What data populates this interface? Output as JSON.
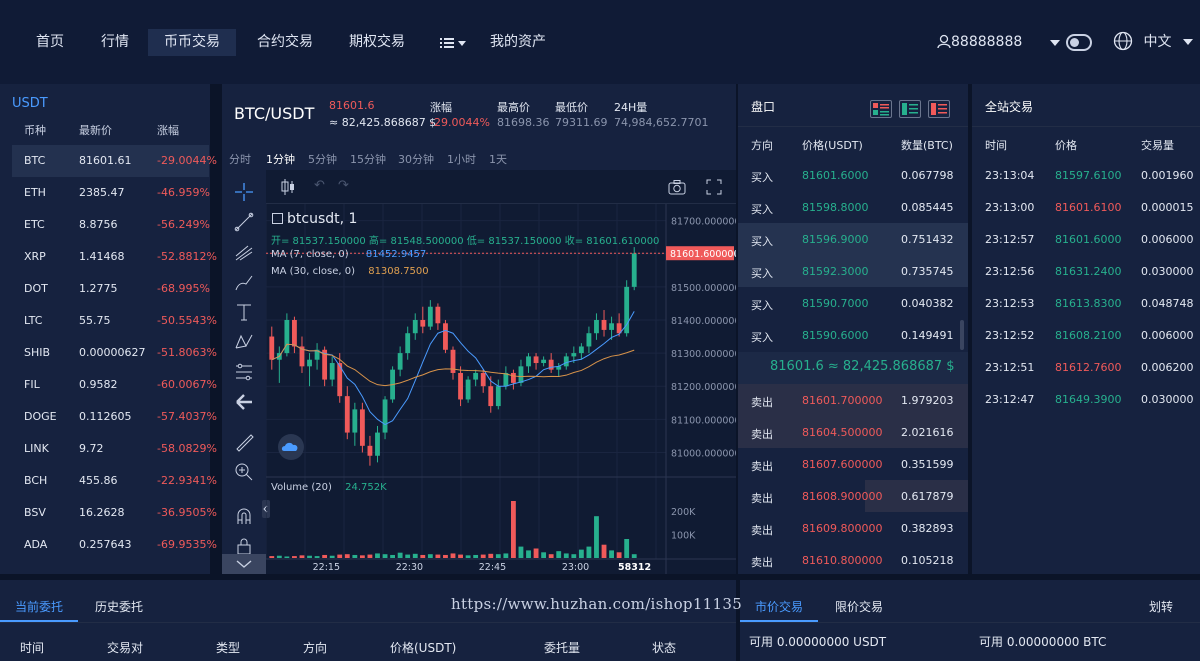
{
  "nav": {
    "items": [
      "首页",
      "行情",
      "币币交易",
      "合约交易",
      "期权交易"
    ],
    "assets": "我的资产",
    "user": "88888888",
    "language": "中文"
  },
  "markets": {
    "title": "USDT",
    "headers": [
      "币种",
      "最新价",
      "涨幅"
    ],
    "rows": [
      {
        "sym": "BTC",
        "price": "81601.61",
        "chg": "-29.0044%"
      },
      {
        "sym": "ETH",
        "price": "2385.47",
        "chg": "-46.959%"
      },
      {
        "sym": "ETC",
        "price": "8.8756",
        "chg": "-56.249%"
      },
      {
        "sym": "XRP",
        "price": "1.41468",
        "chg": "-52.8812%"
      },
      {
        "sym": "DOT",
        "price": "1.2775",
        "chg": "-68.995%"
      },
      {
        "sym": "LTC",
        "price": "55.75",
        "chg": "-50.5543%"
      },
      {
        "sym": "SHIB",
        "price": "0.00000627",
        "chg": "-51.8063%"
      },
      {
        "sym": "FIL",
        "price": "0.9582",
        "chg": "-60.0067%"
      },
      {
        "sym": "DOGE",
        "price": "0.112605",
        "chg": "-57.4037%"
      },
      {
        "sym": "LINK",
        "price": "9.72",
        "chg": "-58.0829%"
      },
      {
        "sym": "BCH",
        "price": "455.86",
        "chg": "-22.9341%"
      },
      {
        "sym": "BSV",
        "price": "16.2628",
        "chg": "-36.9505%"
      },
      {
        "sym": "ADA",
        "price": "0.257643",
        "chg": "-69.9535%"
      }
    ]
  },
  "ticker": {
    "pair": "BTC/USDT",
    "last": "81601.6",
    "last_usd": "≈ 82,425.868687 $",
    "chg_label": "涨幅",
    "chg": "-29.0044%",
    "high_label": "最高价",
    "high": "81698.36",
    "low_label": "最低价",
    "low": "79311.69",
    "vol_label": "24H量",
    "vol": "74,984,652.7701"
  },
  "intervals": [
    "分时",
    "1分钟",
    "5分钟",
    "15分钟",
    "30分钟",
    "1小时",
    "1天"
  ],
  "chart": {
    "symbol": "btcusdt, 1",
    "ohlc": "开= 81537.150000  高= 81548.500000  低= 81537.150000  收= 81601.610000",
    "ma7_label": "MA (7, close, 0)",
    "ma7_val": "81452.9457",
    "ma30_label": "MA (30, close, 0)",
    "ma30_val": "81308.7500",
    "volume_label": "Volume (20)",
    "volume_val": "24.752K",
    "price_ticks": [
      "81700.000000",
      "81600.000000",
      "81500.000000",
      "81400.000000",
      "81300.000000",
      "81200.000000",
      "81100.000000",
      "81000.000000"
    ],
    "current_price": "81601.600000",
    "vol_ticks": [
      "200K",
      "100K"
    ],
    "time_ticks": [
      "22:15",
      "22:30",
      "22:45",
      "23:00"
    ],
    "cursor_time": "58312"
  },
  "chart_data": {
    "type": "candlestick",
    "ylim": [
      80950,
      81720
    ],
    "candles": [
      {
        "o": 81350,
        "h": 81380,
        "l": 81250,
        "c": 81280
      },
      {
        "o": 81280,
        "h": 81320,
        "l": 81210,
        "c": 81300
      },
      {
        "o": 81300,
        "h": 81420,
        "l": 81290,
        "c": 81400
      },
      {
        "o": 81400,
        "h": 81410,
        "l": 81300,
        "c": 81320
      },
      {
        "o": 81320,
        "h": 81350,
        "l": 81240,
        "c": 81260
      },
      {
        "o": 81260,
        "h": 81300,
        "l": 81200,
        "c": 81280
      },
      {
        "o": 81280,
        "h": 81330,
        "l": 81250,
        "c": 81310
      },
      {
        "o": 81310,
        "h": 81320,
        "l": 81200,
        "c": 81220
      },
      {
        "o": 81220,
        "h": 81290,
        "l": 81200,
        "c": 81270
      },
      {
        "o": 81270,
        "h": 81300,
        "l": 81150,
        "c": 81170
      },
      {
        "o": 81170,
        "h": 81200,
        "l": 81040,
        "c": 81060
      },
      {
        "o": 81060,
        "h": 81150,
        "l": 81020,
        "c": 81130
      },
      {
        "o": 81130,
        "h": 81150,
        "l": 81000,
        "c": 81020
      },
      {
        "o": 81020,
        "h": 81050,
        "l": 80960,
        "c": 80990
      },
      {
        "o": 80990,
        "h": 81080,
        "l": 80970,
        "c": 81060
      },
      {
        "o": 81060,
        "h": 81170,
        "l": 81040,
        "c": 81160
      },
      {
        "o": 81160,
        "h": 81260,
        "l": 81150,
        "c": 81250
      },
      {
        "o": 81250,
        "h": 81320,
        "l": 81230,
        "c": 81300
      },
      {
        "o": 81300,
        "h": 81380,
        "l": 81280,
        "c": 81360
      },
      {
        "o": 81360,
        "h": 81420,
        "l": 81340,
        "c": 81400
      },
      {
        "o": 81400,
        "h": 81440,
        "l": 81360,
        "c": 81380
      },
      {
        "o": 81380,
        "h": 81460,
        "l": 81370,
        "c": 81440
      },
      {
        "o": 81440,
        "h": 81450,
        "l": 81370,
        "c": 81390
      },
      {
        "o": 81390,
        "h": 81400,
        "l": 81300,
        "c": 81310
      },
      {
        "o": 81310,
        "h": 81320,
        "l": 81220,
        "c": 81240
      },
      {
        "o": 81240,
        "h": 81260,
        "l": 81140,
        "c": 81160
      },
      {
        "o": 81160,
        "h": 81230,
        "l": 81150,
        "c": 81220
      },
      {
        "o": 81220,
        "h": 81250,
        "l": 81200,
        "c": 81240
      },
      {
        "o": 81240,
        "h": 81250,
        "l": 81180,
        "c": 81200
      },
      {
        "o": 81200,
        "h": 81230,
        "l": 81120,
        "c": 81140
      },
      {
        "o": 81140,
        "h": 81220,
        "l": 81130,
        "c": 81200
      },
      {
        "o": 81200,
        "h": 81260,
        "l": 81190,
        "c": 81240
      },
      {
        "o": 81240,
        "h": 81250,
        "l": 81190,
        "c": 81210
      },
      {
        "o": 81210,
        "h": 81280,
        "l": 81200,
        "c": 81260
      },
      {
        "o": 81260,
        "h": 81300,
        "l": 81240,
        "c": 81290
      },
      {
        "o": 81290,
        "h": 81300,
        "l": 81250,
        "c": 81270
      },
      {
        "o": 81270,
        "h": 81290,
        "l": 81260,
        "c": 81280
      },
      {
        "o": 81280,
        "h": 81300,
        "l": 81240,
        "c": 81250
      },
      {
        "o": 81250,
        "h": 81270,
        "l": 81230,
        "c": 81260
      },
      {
        "o": 81260,
        "h": 81300,
        "l": 81250,
        "c": 81290
      },
      {
        "o": 81290,
        "h": 81320,
        "l": 81270,
        "c": 81300
      },
      {
        "o": 81300,
        "h": 81330,
        "l": 81280,
        "c": 81320
      },
      {
        "o": 81320,
        "h": 81380,
        "l": 81300,
        "c": 81360
      },
      {
        "o": 81360,
        "h": 81420,
        "l": 81340,
        "c": 81400
      },
      {
        "o": 81400,
        "h": 81430,
        "l": 81350,
        "c": 81370
      },
      {
        "o": 81370,
        "h": 81410,
        "l": 81340,
        "c": 81390
      },
      {
        "o": 81390,
        "h": 81420,
        "l": 81350,
        "c": 81360
      },
      {
        "o": 81360,
        "h": 81520,
        "l": 81350,
        "c": 81500
      },
      {
        "o": 81500,
        "h": 81620,
        "l": 81490,
        "c": 81601
      }
    ],
    "volumes": [
      5,
      6,
      4,
      5,
      7,
      6,
      5,
      8,
      6,
      9,
      10,
      8,
      7,
      9,
      12,
      10,
      8,
      14,
      9,
      11,
      8,
      10,
      9,
      8,
      12,
      9,
      7,
      8,
      9,
      11,
      10,
      12,
      150,
      30,
      20,
      25,
      15,
      10,
      18,
      12,
      10,
      22,
      30,
      110,
      35,
      20,
      15,
      50,
      10
    ]
  },
  "orderbook": {
    "title": "盘口",
    "headers": [
      "方向",
      "价格(USDT)",
      "数量(BTC)"
    ],
    "buys": [
      {
        "side": "买入",
        "price": "81601.6000",
        "qty": "0.067798"
      },
      {
        "side": "买入",
        "price": "81598.8000",
        "qty": "0.085445"
      },
      {
        "side": "买入",
        "price": "81596.9000",
        "qty": "0.751432"
      },
      {
        "side": "买入",
        "price": "81592.3000",
        "qty": "0.735745"
      },
      {
        "side": "买入",
        "price": "81590.7000",
        "qty": "0.040382"
      },
      {
        "side": "买入",
        "price": "81590.6000",
        "qty": "0.149491"
      }
    ],
    "mid": "81601.6 ≈ 82,425.868687 $",
    "sells": [
      {
        "side": "卖出",
        "price": "81601.700000",
        "qty": "1.979203"
      },
      {
        "side": "卖出",
        "price": "81604.500000",
        "qty": "2.021616"
      },
      {
        "side": "卖出",
        "price": "81607.600000",
        "qty": "0.351599"
      },
      {
        "side": "卖出",
        "price": "81608.900000",
        "qty": "0.617879"
      },
      {
        "side": "卖出",
        "price": "81609.800000",
        "qty": "0.382893"
      },
      {
        "side": "卖出",
        "price": "81610.800000",
        "qty": "0.105218"
      }
    ]
  },
  "trades": {
    "title": "全站交易",
    "headers": [
      "时间",
      "价格",
      "交易量"
    ],
    "rows": [
      {
        "time": "23:13:04",
        "price": "81597.6100",
        "qty": "0.001960",
        "color": "green"
      },
      {
        "time": "23:13:00",
        "price": "81601.6100",
        "qty": "0.000015",
        "color": "red"
      },
      {
        "time": "23:12:57",
        "price": "81601.6000",
        "qty": "0.006000",
        "color": "green"
      },
      {
        "time": "23:12:56",
        "price": "81631.2400",
        "qty": "0.030000",
        "color": "green"
      },
      {
        "time": "23:12:53",
        "price": "81613.8300",
        "qty": "0.048748",
        "color": "green"
      },
      {
        "time": "23:12:52",
        "price": "81608.2100",
        "qty": "0.006000",
        "color": "green"
      },
      {
        "time": "23:12:51",
        "price": "81612.7600",
        "qty": "0.006200",
        "color": "red"
      },
      {
        "time": "23:12:47",
        "price": "81649.3900",
        "qty": "0.030000",
        "color": "green"
      }
    ]
  },
  "orders": {
    "tab_current": "当前委托",
    "tab_history": "历史委托",
    "headers": [
      "时间",
      "交易对",
      "类型",
      "方向",
      "价格(USDT)",
      "委托量",
      "状态"
    ]
  },
  "trade_form": {
    "tab_market": "市价交易",
    "tab_limit": "限价交易",
    "transfer": "划转",
    "avail_usdt": "可用 0.00000000 USDT",
    "avail_btc": "可用 0.00000000 BTC"
  },
  "watermark": "https://www.huzhan.com/ishop11135",
  "colors": {
    "up": "#27b08e",
    "down": "#f05a5a",
    "accent": "#4a9bff",
    "bg": "#0b1428",
    "panel": "#16223f"
  }
}
